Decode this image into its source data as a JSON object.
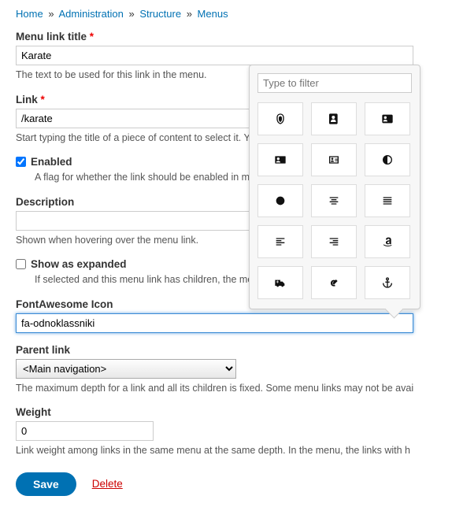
{
  "breadcrumb": [
    {
      "label": "Home"
    },
    {
      "label": "Administration"
    },
    {
      "label": "Structure"
    },
    {
      "label": "Menus"
    }
  ],
  "sep": "»",
  "fields": {
    "title": {
      "label": "Menu link title",
      "value": "Karate",
      "help": "The text to be used for this link in the menu."
    },
    "link": {
      "label": "Link",
      "value": "/karate",
      "help": "Start typing the title of a piece of content to select it. You can also enter an internal path su"
    },
    "enabled": {
      "label": "Enabled",
      "help": "A flag for whether the link should be enabled in menus or hidden."
    },
    "description": {
      "label": "Description",
      "value": "",
      "help": "Shown when hovering over the menu link."
    },
    "expanded": {
      "label": "Show as expanded",
      "help": "If selected and this menu link has children, the menu will always appear expanded."
    },
    "icon": {
      "label": "FontAwesome Icon",
      "value": "fa-odnoklassniki"
    },
    "parent": {
      "label": "Parent link",
      "value": "<Main navigation>",
      "help": "The maximum depth for a link and all its children is fixed. Some menu links may not be avai"
    },
    "weight": {
      "label": "Weight",
      "value": "0",
      "help": "Link weight among links in the same menu at the same depth. In the menu, the links with h"
    }
  },
  "popover": {
    "filter_placeholder": "Type to filter",
    "icons": [
      "fingerprint-icon",
      "address-book-icon",
      "id-card-icon",
      "contact-card-icon",
      "id-badge-icon",
      "adjust-icon",
      "dot-circle-icon",
      "align-center-icon",
      "align-justify-icon",
      "align-left-icon",
      "align-right-icon",
      "amazon-icon",
      "ambulance-icon",
      "asl-icon",
      "anchor-icon"
    ]
  },
  "actions": {
    "save": "Save",
    "delete": "Delete"
  }
}
